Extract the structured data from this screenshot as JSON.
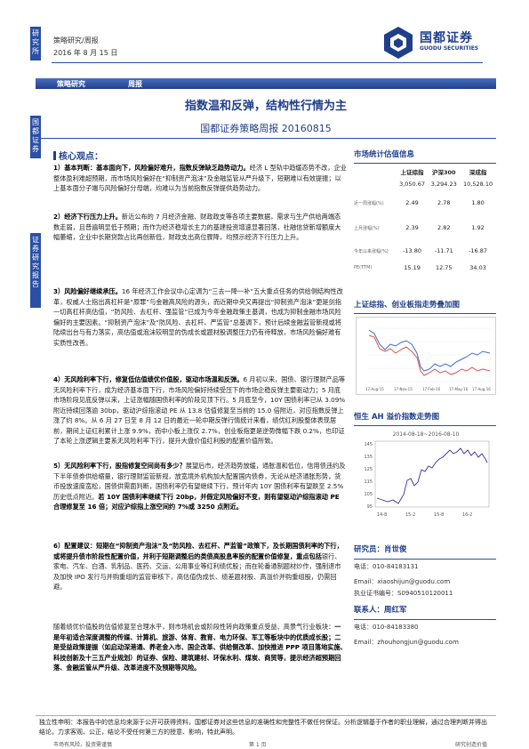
{
  "side": {
    "tag1": "研究所",
    "tag2": "国都证券",
    "tag3": "证券研究报告"
  },
  "header": {
    "report_type": "策略研究/周报",
    "date": "2016 年 8 月 15 日",
    "logo_cn": "国都证券",
    "logo_en": "GUODU SECURITIES"
  },
  "bar": {
    "left": "策略研究",
    "right": "周报"
  },
  "title": "指数温和反弹，结构性行情为主",
  "subtitle": "国都证券策略周报 20160815",
  "key_heading": "核心观点：",
  "paras": {
    "p1_head": "1）基本判断：基本面向下，风险偏好难升，指数反弹缺乏趋势动力。",
    "p1_body": "经济 L 型轨中趋缓态势不改，企业整体盈利难超预期，而市场风险偏好在“抑制资产泡沫”及金融监管从严升级下，短期难以有效提振；以上基本面分子端与风险偏好分母端，均难以为当前指数反弹提供趋势动力。",
    "p2_head": "2）经济下行压力上升。",
    "p2_body": "新近公布的 7 月经济金融、财政政支等各项主要数据，需求与生产供给两端态数走弱，且普遍明显低于预期；而作为经济稳增长主力的基建投资增速显著回落，社融信贷新增额度大幅萎缩，企业中长期贷款占比再创新低，财政支出高位骤降，均预示经济下行压力上升。",
    "p3_head": "3）风险偏好继续承压。",
    "p3_body": "16 年经济工作会议中心定调为“三去一降一补”五大重点任务的供给侧结构性改革，权威人士指出高杠杆是“原罪”与金融高风险的源头，而近期中央又再提出“抑制资产泡沫”更是剑指一切高杠杆高估值，“防风险、去杠杆、强监管”已成为今年金融政策主基调，也成为抑制金融市场风险偏好的主要因素。“抑制资产泡沫”及“防风险、去杠杆、严监管”总基调下，预计后续金融监管新规或将陆续出台与有力落实，高估值或泡沫较明显的伪成长或题材股调整压力仍有待释放，市场风险偏好难有实质性改善。",
    "p4_head": "4）无风险利率下行，修复低估值绩优价值股，驱动市场温和反弹。",
    "p4_body": "6 月初以来，国债、银行理财产品等无风险利率下行，成为经济基本面下行，市场风险偏好持续受压下的市场企稳反弹主要驱动力；5 月底市场阶段见底反弹以来，上证涨幅随国债利率的阶段见顶下行。5 月底至今，10Y 国债利率已从 3.09%附近持续回落逾 30bp，驱动沪综指滚动 PE 从 13.8 估值修复至当前的 15.0 倍附近，对应指数反弹上涨了约 8%。从 6 月 27 日至 8 月 12 日的最近一轮中期反弹行情统计来看，绩优红利股整体表现居前，期间上证红利累计上涨 9.9%，而中小板上涨仅 2.7%，创业板指更是逆势微幅下跌 0.2%，也印证了本轮上涨逻辑主要系无风险利率下行，提升大盘价值红利股的配置价值所致。",
    "p5_head": "5）无风险利率下行，股指修复空间尚有多少？",
    "p5_body": "展望后市，经济趋势放缓，通胀温和低位，信用债违约及下半年债券供给缩量，银行理财监管新规，放宽境外机构加大配置国内债券，无论从经济通胀形势，货币投放速度宽松，国债供需面判断，国债利率仍有望继续下行，预计年内 10Y 国债利率有望跌至 2.5%历史低点附近。",
    "p5_bold": "若 10Y 国债利率继续下行 20bp，并假定风险偏好不变，则有望驱动沪综指滚动 PE 合理修复至 16 倍；对应沪综指上涨空间约 7%或 3250 点附近。",
    "p6_head": "6）配置建议：短期在“抑制资产泡沫”及“防风险、去杠杆、严监管”政策下，及长期国债利率的下行，或将提升债市阶段性配置价值，并利于短期调整后的类债高股息率股的配置价值修复，重点包括",
    "p6_body": "银行、家电、汽车、白酒、乳制品、医药、交运、公用事业等红利绩优股；而在轮番通制题材炒作，强制退市及加快 IPO 发行与并购重组的监管审核下，高估值伪成长、绩差题材股、高溢价并购重组股，仍需回避。",
    "p7_body": "随着绩优价值股的估值修复至合理水平，则市场机会或阶段性转向政策重点受益、高景气行业板块：",
    "p7_bold": "一是年初适合深度调整的传媒、计算机、旅游、体育、教育、电力环保、军工等板块中的优质成长股；二是受益政策提振（如启动深港通、养老金入市、国企改革、供给侧改革、加快推进 PPP 项目落地实施、科技创新及十三五产业规划）的证券、保险、建筑建材、环保水利、煤炭、商贸等，提示经济超预期回落、金融监管从严升级、改革进度不及预期等风险。"
  },
  "market": {
    "heading": "市场统计估值信息",
    "col1": "上证综指",
    "col2": "沪深300",
    "col3": "深成指",
    "rows": [
      {
        "label": "",
        "v1": "3,050.67",
        "v2": "3,294.23",
        "v3": "10,528.10"
      },
      {
        "label": "近一周涨幅(%)",
        "v1": "2.49",
        "v2": "2.78",
        "v3": "1.80"
      },
      {
        "label": "上月涨幅(%)",
        "v1": "2.39",
        "v2": "2.82",
        "v3": "1.92"
      },
      {
        "label": "今年以来涨幅(%)",
        "v1": "-13.80",
        "v2": "-11.71",
        "v3": "-16.87"
      },
      {
        "label": "PE(TTM)",
        "v1": "15.19",
        "v2": "12.75",
        "v3": "34.03"
      }
    ]
  },
  "chart1": {
    "heading": "上证综指、创业板指走势叠加图",
    "x_ticks": [
      "17-Aug-15",
      "17-Nov-15",
      "17-Feb-16",
      "17-May-16",
      "17-Aug-16"
    ]
  },
  "chart2": {
    "heading": "恒生 AH 溢价指数走势图",
    "subtitle": "2014-08-18~2016-08-10",
    "y_ticks": [
      "145",
      "135",
      "125",
      "115",
      "105",
      "95"
    ],
    "x_ticks": [
      "14-8",
      "15-2",
      "15-8",
      "16-2"
    ]
  },
  "contacts": {
    "heading1": "研究员：肖世俊",
    "tel1": "电话：010-84183131",
    "email1": "Email：xiaoshijun@guodu.com",
    "cert1": "执业证书编号：S0940510120011",
    "heading2": "联系人：周红军",
    "tel2": "电话：010-84183380",
    "email2": "Email：zhouhongjun@guodu.com"
  },
  "footer": {
    "declaration": "独立性申明：本报告中的信息均来源于公开可获得资料，国都证券对这些信息的准确性和完整性不做任何保证。分析逻辑基于作者的职业理解，通过合理判断并得出结论，力求客观、公正，结论不受任何第三方的授意、影响，特此声明。",
    "left": "市场有风险，投资需谨慎",
    "center": "第 1 页",
    "right": "研究创造价值"
  }
}
